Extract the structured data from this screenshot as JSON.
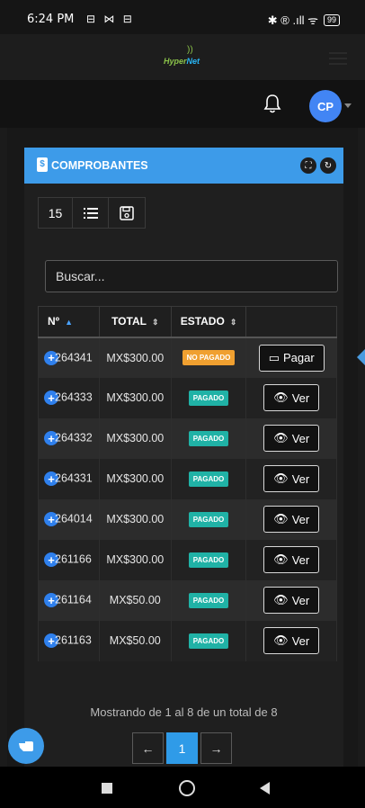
{
  "status_bar": {
    "time": "6:24 PM",
    "left_icons": "⊟ ⋈ ⊟",
    "right_icons": "✱ ® .ıll ᯤ",
    "battery": "99"
  },
  "header": {
    "logo_text_1": "Hyper",
    "logo_text_2": "Net",
    "logo_wave": "))"
  },
  "toolbar": {
    "avatar_initials": "CP"
  },
  "card": {
    "title": "COMPROBANTES",
    "doc_icon": "$",
    "fullscreen_icon": "⛶",
    "refresh_icon": "↻"
  },
  "controls": {
    "page_size": "15",
    "list_icon": "☰",
    "save_icon": "💾"
  },
  "search": {
    "placeholder": "Buscar..."
  },
  "table": {
    "headers": {
      "num": "Nº",
      "total": "TOTAL",
      "status": "ESTADO"
    },
    "sort_asc": "▲",
    "sort_both": "⇕",
    "rows": [
      {
        "num": "264341",
        "total": "MX$300.00",
        "status": "NO PAGADO",
        "action": "Pagar",
        "action_icon": "▭"
      },
      {
        "num": "264333",
        "total": "MX$300.00",
        "status": "PAGADO",
        "action": "Ver",
        "action_icon": "👁"
      },
      {
        "num": "264332",
        "total": "MX$300.00",
        "status": "PAGADO",
        "action": "Ver",
        "action_icon": "👁"
      },
      {
        "num": "264331",
        "total": "MX$300.00",
        "status": "PAGADO",
        "action": "Ver",
        "action_icon": "👁"
      },
      {
        "num": "264014",
        "total": "MX$300.00",
        "status": "PAGADO",
        "action": "Ver",
        "action_icon": "👁"
      },
      {
        "num": "261166",
        "total": "MX$300.00",
        "status": "PAGADO",
        "action": "Ver",
        "action_icon": "👁"
      },
      {
        "num": "261164",
        "total": "MX$50.00",
        "status": "PAGADO",
        "action": "Ver",
        "action_icon": "👁"
      },
      {
        "num": "261163",
        "total": "MX$50.00",
        "status": "PAGADO",
        "action": "Ver",
        "action_icon": "👁"
      }
    ]
  },
  "pagination": {
    "info": "Mostrando de 1 al 8 de un total de 8",
    "prev": "←",
    "current": "1",
    "next": "→"
  },
  "colors": {
    "accent": "#3d9be9",
    "unpaid": "#f0a030",
    "paid": "#20b2a6"
  }
}
